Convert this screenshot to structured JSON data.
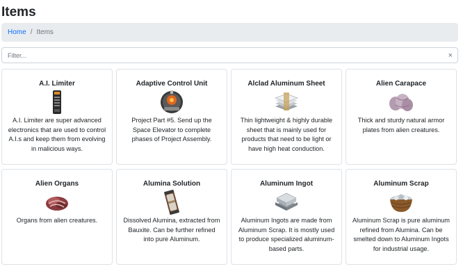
{
  "page": {
    "title": "Items"
  },
  "breadcrumb": {
    "home": "Home",
    "separator": "/",
    "current": "Items"
  },
  "filter": {
    "placeholder": "Filter...",
    "value": "",
    "clear_label": "×"
  },
  "items": [
    {
      "name": "A.I. Limiter",
      "icon": "ai-limiter-icon",
      "description": "A.I. Limiter are super advanced electronics that are used to control A.I.s and keep them from evolving in malicious ways."
    },
    {
      "name": "Adaptive Control Unit",
      "icon": "adaptive-control-unit-icon",
      "description": "Project Part #5. Send up the Space Elevator to complete phases of Project Assembly."
    },
    {
      "name": "Alclad Aluminum Sheet",
      "icon": "alclad-aluminum-sheet-icon",
      "description": "Thin lightweight & highly durable sheet that is mainly used for products that need to be light or have high heat conduction."
    },
    {
      "name": "Alien Carapace",
      "icon": "alien-carapace-icon",
      "description": "Thick and sturdy natural armor plates from alien creatures."
    },
    {
      "name": "Alien Organs",
      "icon": "alien-organs-icon",
      "description": "Organs from alien creatures."
    },
    {
      "name": "Alumina Solution",
      "icon": "alumina-solution-icon",
      "description": "Dissolved Alumina, extracted from Bauxite. Can be further refined into pure Aluminum."
    },
    {
      "name": "Aluminum Ingot",
      "icon": "aluminum-ingot-icon",
      "description": "Aluminum Ingots are made from Aluminum Scrap. It is mostly used to produce specialized aluminum-based parts."
    },
    {
      "name": "Aluminum Scrap",
      "icon": "aluminum-scrap-icon",
      "description": "Aluminum Scrap is pure aluminum refined from Alumina. Can be smelted down to Aluminum Ingots for industrial usage."
    }
  ]
}
